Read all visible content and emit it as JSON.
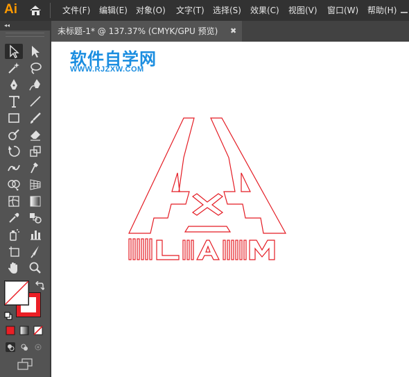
{
  "app": {
    "logo_text": "Ai",
    "accent_color": "#ff9a00"
  },
  "menubar": {
    "items": [
      {
        "label": "文件(F)"
      },
      {
        "label": "编辑(E)"
      },
      {
        "label": "对象(O)"
      },
      {
        "label": "文字(T)"
      },
      {
        "label": "选择(S)"
      },
      {
        "label": "效果(C)"
      },
      {
        "label": "视图(V)"
      },
      {
        "label": "窗口(W)"
      },
      {
        "label": "帮助(H)"
      }
    ],
    "icons": [
      "home-icon",
      "minimize-icon"
    ]
  },
  "document_tab": {
    "title": "未标题-1* @ 137.37% (CMYK/GPU 预览)",
    "close_glyph": "✖"
  },
  "toolbar": {
    "collapse_glyph": "◂◂",
    "tools": [
      "selection-tool-icon",
      "direct-selection-tool-icon",
      "magic-wand-tool-icon",
      "lasso-tool-icon",
      "pen-tool-icon",
      "curvature-tool-icon",
      "type-tool-icon",
      "line-segment-tool-icon",
      "rectangle-tool-icon",
      "paintbrush-tool-icon",
      "shaper-tool-icon",
      "eraser-tool-icon",
      "rotate-tool-icon",
      "scale-tool-icon",
      "width-tool-icon",
      "puppet-warp-tool-icon",
      "shape-builder-tool-icon",
      "perspective-grid-tool-icon",
      "mesh-tool-icon",
      "gradient-tool-icon",
      "eyedropper-tool-icon",
      "blend-tool-icon",
      "symbol-sprayer-tool-icon",
      "column-graph-tool-icon",
      "artboard-tool-icon",
      "slice-tool-icon",
      "hand-tool-icon",
      "zoom-tool-icon"
    ],
    "fill_color": "#ffffff",
    "stroke_color": "#ea1f26"
  },
  "canvas": {
    "background": "#ffffff",
    "watermark": {
      "title": "软件自学网",
      "url": "WWW.RJZXW.COM",
      "color": "#1a8de0"
    },
    "artwork": {
      "text": "LIAM",
      "stroke_color": "#e41b23"
    }
  }
}
